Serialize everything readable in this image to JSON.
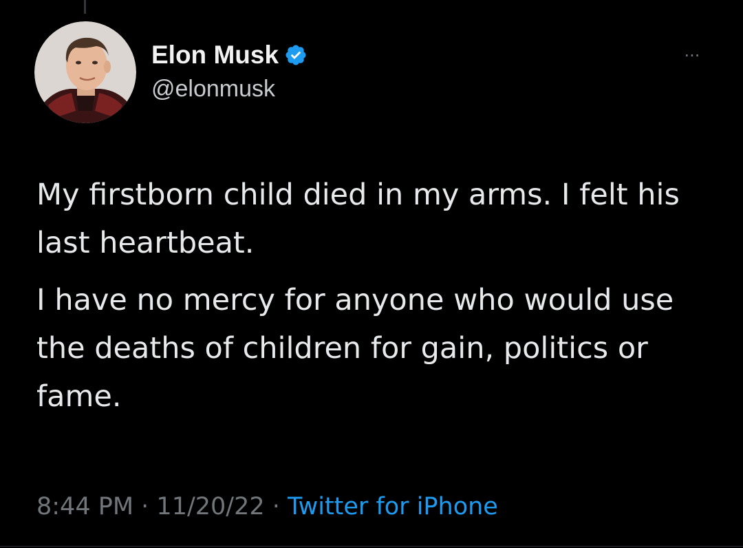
{
  "tweet": {
    "author": {
      "display_name": "Elon Musk",
      "handle": "@elonmusk",
      "verified_icon": "verified-badge-icon",
      "avatar_icon": "avatar-photo"
    },
    "more_label": "···",
    "text": {
      "paragraph_1": "My firstborn child died in my arms. I felt his last heartbeat.",
      "paragraph_2": "I have no mercy for anyone who would use the deaths of children for gain, politics or fame."
    },
    "meta": {
      "time": "8:44 PM",
      "separator": " · ",
      "date": "11/20/22",
      "source": "Twitter for iPhone"
    }
  },
  "colors": {
    "background": "#000000",
    "text_primary": "#e7e9ea",
    "text_secondary": "#71767b",
    "accent": "#1d9bf0"
  }
}
